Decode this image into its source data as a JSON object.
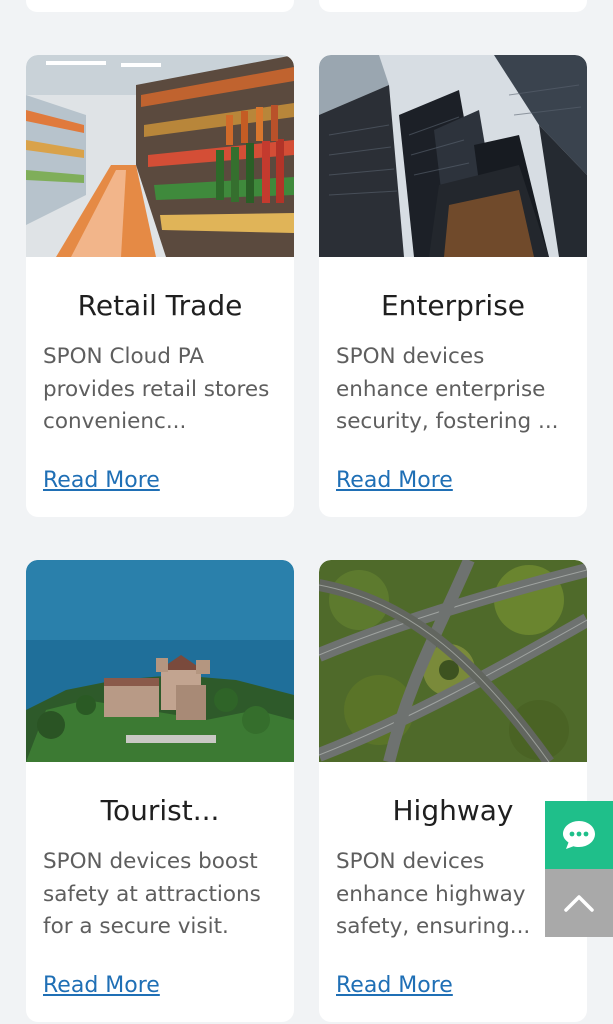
{
  "cards": [
    {
      "title": "Retail Trade",
      "description": "SPON Cloud PA provides retail stores convenienc...",
      "link": "Read More",
      "image": "supermarket-aisle-image"
    },
    {
      "title": "Enterprise",
      "description": "SPON devices enhance enterprise security, fostering ...",
      "link": "Read More",
      "image": "office-skyscrapers-image"
    },
    {
      "title": "Tourist...",
      "description": "SPON devices boost safety at attractions for a secure visit.",
      "link": "Read More",
      "image": "lakeside-castle-image"
    },
    {
      "title": "Highway",
      "description": "SPON devices enhance highway safety, ensuring...",
      "link": "Read More",
      "image": "highway-interchange-image"
    }
  ],
  "floating": {
    "chat_icon": "chat-bubble-icon",
    "top_icon": "chevron-up-icon",
    "colors": {
      "chat": "#1fbf8a",
      "top": "#a9a9a9"
    }
  },
  "colors": {
    "link": "#1f6fb5",
    "background": "#f1f3f5"
  }
}
